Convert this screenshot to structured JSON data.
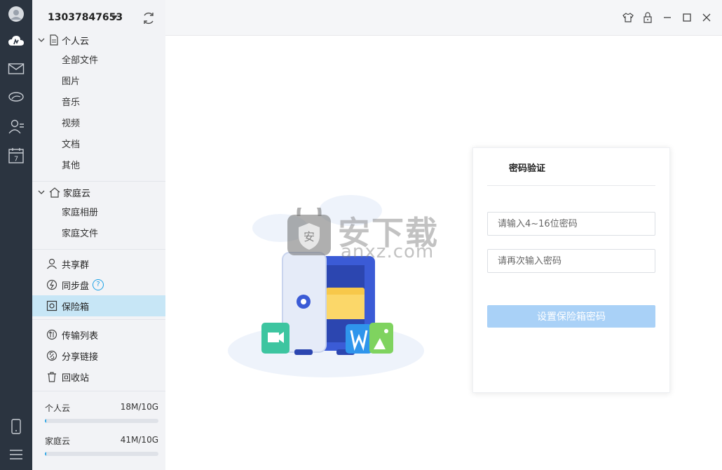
{
  "account": {
    "phone": "13037847653"
  },
  "sidebar": {
    "personal_cloud": {
      "label": "个人云",
      "items": [
        "全部文件",
        "图片",
        "音乐",
        "视频",
        "文档",
        "其他"
      ]
    },
    "family_cloud": {
      "label": "家庭云",
      "items": [
        "家庭相册",
        "家庭文件"
      ]
    },
    "nav1": [
      {
        "label": "共享群",
        "icon": "user-icon"
      },
      {
        "label": "同步盘",
        "icon": "sync-disk-icon",
        "help": "?"
      },
      {
        "label": "保险箱",
        "icon": "safe-icon",
        "active": true
      }
    ],
    "nav2": [
      {
        "label": "传输列表",
        "icon": "transfer-icon"
      },
      {
        "label": "分享链接",
        "icon": "link-icon"
      },
      {
        "label": "回收站",
        "icon": "trash-icon"
      }
    ],
    "storage": [
      {
        "label": "个人云",
        "value": "18M/10G",
        "fraction": 0.0018
      },
      {
        "label": "家庭云",
        "value": "41M/10G",
        "fraction": 0.004
      }
    ]
  },
  "rail": [
    "avatar-icon",
    "cloud-icon",
    "mail-icon",
    "chat-icon",
    "contacts-icon",
    "calendar-icon",
    "phone-icon",
    "menu-icon"
  ],
  "rail_calendar_day": "7",
  "watermark": {
    "text": "安下载",
    "sub": "anxz.com",
    "badge": "安"
  },
  "password_card": {
    "title": "密码验证",
    "password_placeholder": "请输入4~16位密码",
    "confirm_placeholder": "请再次输入密码",
    "submit_label": "设置保险箱密码"
  },
  "colors": {
    "accent": "#2aa5e6",
    "active_bg": "#c7e6f6",
    "rail_bg": "#2b3440",
    "button_disabled": "#a9d1f7"
  }
}
